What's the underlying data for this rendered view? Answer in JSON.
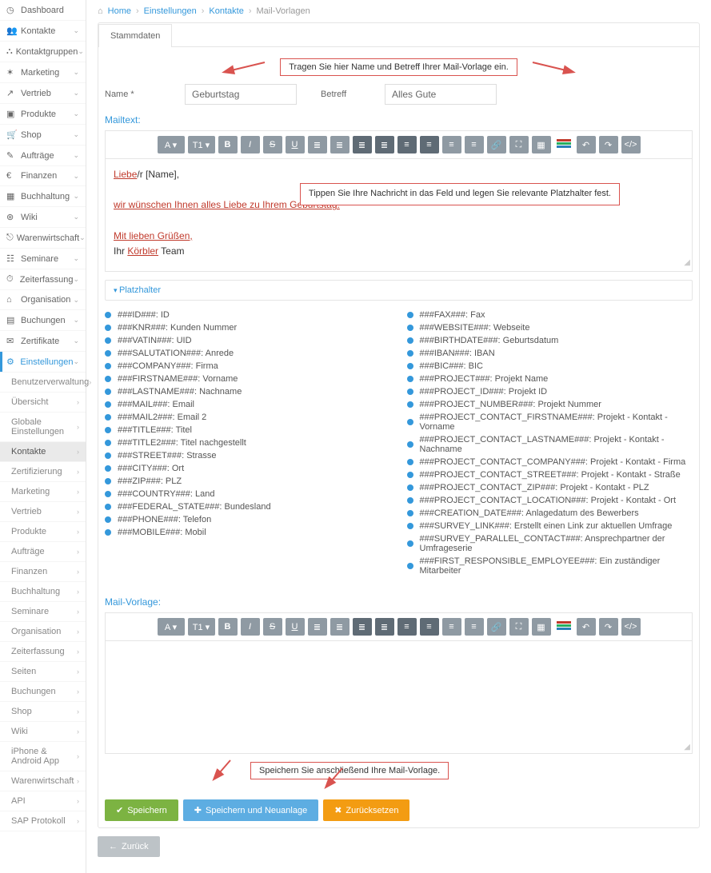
{
  "sidebar": {
    "main": [
      {
        "icon": "◷",
        "label": "Dashboard",
        "chev": ""
      },
      {
        "icon": "👥",
        "label": "Kontakte",
        "chev": "⌄"
      },
      {
        "icon": "⛬",
        "label": "Kontaktgruppen",
        "chev": "⌄"
      },
      {
        "icon": "✶",
        "label": "Marketing",
        "chev": "⌄"
      },
      {
        "icon": "↗",
        "label": "Vertrieb",
        "chev": "⌄"
      },
      {
        "icon": "▣",
        "label": "Produkte",
        "chev": "⌄"
      },
      {
        "icon": "🛒",
        "label": "Shop",
        "chev": "⌄"
      },
      {
        "icon": "✎",
        "label": "Aufträge",
        "chev": "⌄"
      },
      {
        "icon": "€",
        "label": "Finanzen",
        "chev": "⌄"
      },
      {
        "icon": "▦",
        "label": "Buchhaltung",
        "chev": "⌄"
      },
      {
        "icon": "⊛",
        "label": "Wiki",
        "chev": "⌄"
      },
      {
        "icon": "⎋",
        "label": "Warenwirtschaft",
        "chev": "⌄"
      },
      {
        "icon": "☷",
        "label": "Seminare",
        "chev": "⌄"
      },
      {
        "icon": "⏱",
        "label": "Zeiterfassung",
        "chev": "⌄"
      },
      {
        "icon": "⌂",
        "label": "Organisation",
        "chev": "⌄"
      },
      {
        "icon": "▤",
        "label": "Buchungen",
        "chev": "⌄"
      },
      {
        "icon": "✉",
        "label": "Zertifikate",
        "chev": "⌄"
      },
      {
        "icon": "⚙",
        "label": "Einstellungen",
        "chev": "⌄",
        "active": true
      }
    ],
    "sub": [
      {
        "label": "Benutzerverwaltung"
      },
      {
        "label": "Übersicht"
      },
      {
        "label": "Globale Einstellungen"
      },
      {
        "label": "Kontakte",
        "active": true
      },
      {
        "label": "Zertifizierung"
      },
      {
        "label": "Marketing"
      },
      {
        "label": "Vertrieb"
      },
      {
        "label": "Produkte"
      },
      {
        "label": "Aufträge"
      },
      {
        "label": "Finanzen"
      },
      {
        "label": "Buchhaltung"
      },
      {
        "label": "Seminare"
      },
      {
        "label": "Organisation"
      },
      {
        "label": "Zeiterfassung"
      },
      {
        "label": "Seiten"
      },
      {
        "label": "Buchungen"
      },
      {
        "label": "Shop"
      },
      {
        "label": "Wiki"
      },
      {
        "label": "iPhone & Android App"
      },
      {
        "label": "Warenwirtschaft"
      },
      {
        "label": "API"
      },
      {
        "label": "SAP Protokoll"
      }
    ]
  },
  "breadcrumb": {
    "home": "Home",
    "b1": "Einstellungen",
    "b2": "Kontakte",
    "b3": "Mail-Vorlagen"
  },
  "tab": "Stammdaten",
  "hints": {
    "top": "Tragen Sie hier Name und Betreff Ihrer Mail-Vorlage ein.",
    "editor": "Tippen Sie Ihre Nachricht in das Feld und legen Sie relevante Platzhalter fest.",
    "save": "Speichern Sie anschließend Ihre Mail-Vorlage."
  },
  "form": {
    "name_label": "Name *",
    "name_value": "Geburtstag",
    "betreff_label": "Betreff",
    "betreff_value": "Alles Gute"
  },
  "labels": {
    "mailtext": "Mailtext:",
    "platzhalter": "Platzhalter",
    "mailvorlage": "Mail-Vorlage:"
  },
  "editor_content": {
    "l1a": "Liebe",
    "l1b": "/r [Name],",
    "l2": "wir wünschen Ihnen alles Liebe zu Ihrem Geburtstag.",
    "l3": "Mit lieben Grüßen,",
    "l4a": "Ihr ",
    "l4b": "Körbler",
    "l4c": " Team"
  },
  "placeholders": {
    "left": [
      "###ID###: ID",
      "###KNR###: Kunden Nummer",
      "###VATIN###: UID",
      "###SALUTATION###: Anrede",
      "###COMPANY###: Firma",
      "###FIRSTNAME###: Vorname",
      "###LASTNAME###: Nachname",
      "###MAIL###: Email",
      "###MAIL2###: Email 2",
      "###TITLE###: Titel",
      "###TITLE2###: Titel nachgestellt",
      "###STREET###: Strasse",
      "###CITY###: Ort",
      "###ZIP###: PLZ",
      "###COUNTRY###: Land",
      "###FEDERAL_STATE###: Bundesland",
      "###PHONE###: Telefon",
      "###MOBILE###: Mobil"
    ],
    "right": [
      "###FAX###: Fax",
      "###WEBSITE###: Webseite",
      "###BIRTHDATE###: Geburtsdatum",
      "###IBAN###: IBAN",
      "###BIC###: BIC",
      "###PROJECT###: Projekt Name",
      "###PROJECT_ID###: Projekt ID",
      "###PROJECT_NUMBER###: Projekt Nummer",
      "###PROJECT_CONTACT_FIRSTNAME###: Projekt - Kontakt - Vorname",
      "###PROJECT_CONTACT_LASTNAME###: Projekt - Kontakt - Nachname",
      "###PROJECT_CONTACT_COMPANY###: Projekt - Kontakt - Firma",
      "###PROJECT_CONTACT_STREET###: Projekt - Kontakt - Straße",
      "###PROJECT_CONTACT_ZIP###: Projekt - Kontakt - PLZ",
      "###PROJECT_CONTACT_LOCATION###: Projekt - Kontakt - Ort",
      "###CREATION_DATE###: Anlagedatum des Bewerbers",
      "###SURVEY_LINK###: Erstellt einen Link zur aktuellen Umfrage",
      "###SURVEY_PARALLEL_CONTACT###: Ansprechpartner der Umfrageserie",
      "###FIRST_RESPONSIBLE_EMPLOYEE###: Ein zuständiger Mitarbeiter"
    ]
  },
  "buttons": {
    "save": "Speichern",
    "save_new": "Speichern und Neuanlage",
    "reset": "Zurücksetzen",
    "back": "Zurück"
  },
  "toolbar_icons": [
    "A ▾",
    "T1 ▾",
    "B",
    "I",
    "S",
    "U",
    "≣",
    "≣",
    "≣",
    "≣",
    "≡",
    "≡",
    "≡",
    "≡",
    "🔗",
    "⛶",
    "▦",
    "IMG",
    "↶",
    "↷",
    "</>"
  ]
}
